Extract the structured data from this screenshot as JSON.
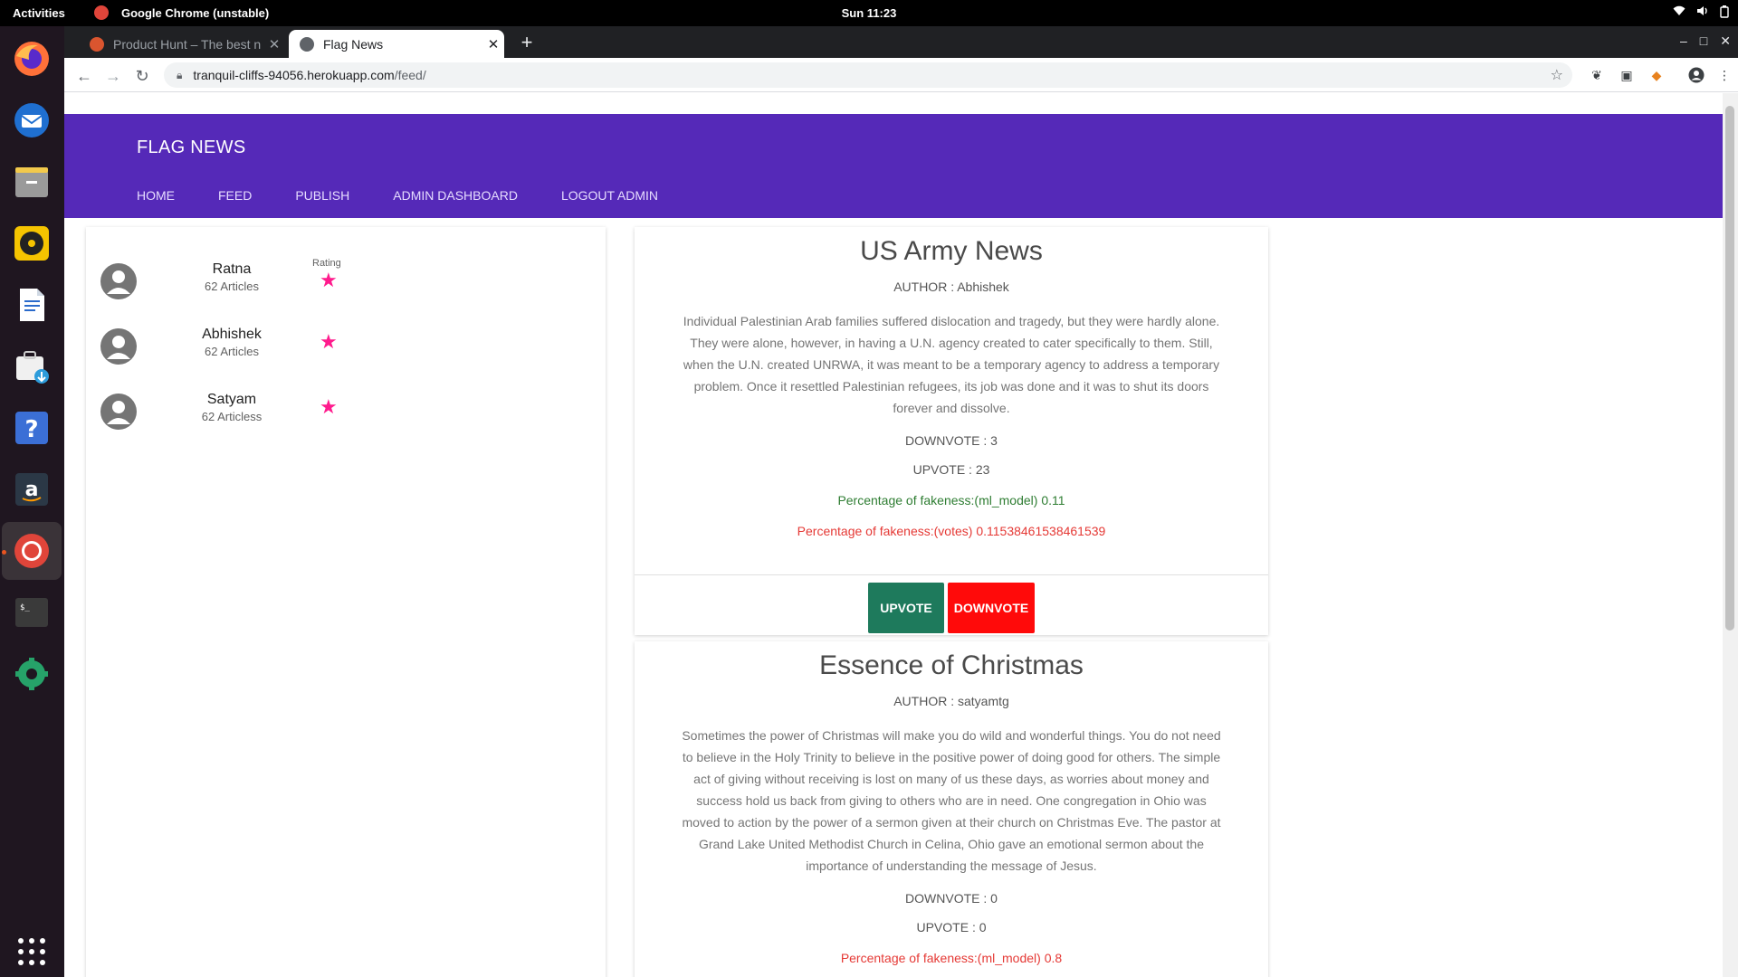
{
  "system": {
    "activities": "Activities",
    "app_name": "Google Chrome (unstable)",
    "clock": "Sun 11:23"
  },
  "browser": {
    "tabs": [
      {
        "title": "Product Hunt – The best n",
        "active": false,
        "favicon_color": "#da552f"
      },
      {
        "title": "Flag News",
        "active": true
      }
    ],
    "url_host": "tranquil-cliffs-94056.herokuapp.com",
    "url_path": "/feed/"
  },
  "site": {
    "brand": "FLAG NEWS",
    "nav": [
      "HOME",
      "FEED",
      "PUBLISH",
      "ADMIN DASHBOARD",
      "LOGOUT ADMIN"
    ],
    "accent": "#5529b8",
    "star_color": "#ff1b8d"
  },
  "authors": {
    "rating_label": "Rating",
    "items": [
      {
        "name": "Ratna",
        "count": "62 Articles"
      },
      {
        "name": "Abhishek",
        "count": "62 Articles"
      },
      {
        "name": "Satyam",
        "count": "62 Articless"
      }
    ]
  },
  "articles": [
    {
      "title": "US Army News",
      "author": "AUTHOR : Abhishek",
      "body": "Individual Palestinian Arab families suffered dislocation and tragedy, but they were hardly alone. They were alone, however, in having a U.N. agency created to cater specifically to them. Still, when the U.N. created UNRWA, it was meant to be a temporary agency to address a temporary problem. Once it resettled Palestinian refugees, its job was done and it was to shut its doors forever and dissolve.",
      "downvote": "DOWNVOTE : 3",
      "upvote": "UPVOTE : 23",
      "ml": "Percentage of fakeness:(ml_model) 0.11",
      "votes": "Percentage of fakeness:(votes) 0.11538461538461539",
      "upvote_btn": "UPVOTE",
      "downvote_btn": "DOWNVOTE"
    },
    {
      "title": "Essence of Christmas",
      "author": "AUTHOR : satyamtg",
      "body": "Sometimes the power of Christmas will make you do wild and wonderful things. You do not need to believe in the Holy Trinity to believe in the positive power of doing good for others. The simple act of giving without receiving is lost on many of us these days, as worries about money and success hold us back from giving to others who are in need. One congregation in Ohio was moved to action by the power of a sermon given at their church on Christmas Eve. The pastor at Grand Lake United Methodist Church in Celina, Ohio gave an emotional sermon about the importance of understanding the message of Jesus.",
      "downvote": "DOWNVOTE : 0",
      "upvote": "UPVOTE : 0",
      "ml": "Percentage of fakeness:(ml_model) 0.8"
    }
  ]
}
